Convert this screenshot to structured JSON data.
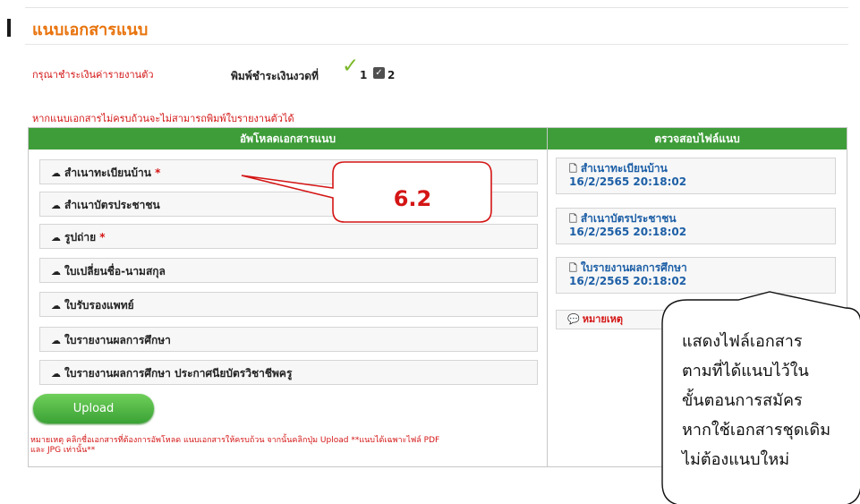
{
  "page": {
    "title": "แนบเอกสารแนบ",
    "payment_notice": "กรุณาชำระเงินค่ารายงานตัว",
    "print_label": "พิมพ์ชำระเงินงวดที่",
    "installments": [
      "1",
      "2"
    ],
    "warning": "หากแนบเอกสารไม่ครบถ้วนจะไม่สามารถพิมพ์ใบรายงานตัวได้"
  },
  "upload_panel": {
    "header": "อัพโหลดเอกสารแนบ",
    "items": [
      {
        "label": "สำเนาทะเบียนบ้าน",
        "required": "*"
      },
      {
        "label": "สำเนาบัตรประชาชน",
        "required": ""
      },
      {
        "label": "รูปถ่าย",
        "required": "*"
      },
      {
        "label": "ใบเปลี่ยนชื่อ-นามสกุล",
        "required": ""
      },
      {
        "label": "ใบรับรองแพทย์",
        "required": ""
      },
      {
        "label": "ใบรายงานผลการศึกษา",
        "required": ""
      },
      {
        "label": "ใบรายงานผลการศึกษา ประกาศนียบัตรวิชาชีพครู",
        "required": ""
      }
    ],
    "upload_button": "Upload",
    "note_line1": "หมายเหตุ คลิกชื่อเอกสารที่ต้องการอัพโหลด แนบเอกสารให้ครบถ้วน จากนั้นคลิกปุ่ม Upload **แนบได้เฉพาะไฟล์ PDF",
    "note_line2": "และ JPG เท่านั้น**"
  },
  "check_panel": {
    "header": "ตรวจสอบไฟล์แนบ",
    "files": [
      {
        "name": "สำเนาทะเบียนบ้าน",
        "timestamp": "16/2/2565 20:18:02"
      },
      {
        "name": "สำเนาบัตรประชาชน",
        "timestamp": "16/2/2565 20:18:02"
      },
      {
        "name": "ใบรายงานผลการศึกษา",
        "timestamp": "16/2/2565 20:18:02"
      }
    ],
    "remark": "หมายเหตุ"
  },
  "annotations": {
    "step_label": "6.2",
    "explanation_lines": [
      "แสดงไฟล์เอกสาร",
      "ตามที่ได้แนบไว้ใน",
      "ขั้นตอนการสมัคร",
      "หากใช้เอกสารชุดเดิม",
      "ไม่ต้องแนบใหม่"
    ]
  },
  "icons": {
    "upload_icon": "cloud-upload-icon",
    "file_icon": "pdf-file-icon",
    "remark_icon": "speech-bubble-icon",
    "check_icon": "checkmark-icon"
  },
  "colors": {
    "title": "#e8730c",
    "warning": "#d41515",
    "panel_header": "#3e9d39",
    "file_link": "#1d5fa6",
    "upload_button": "#4cb43f"
  }
}
